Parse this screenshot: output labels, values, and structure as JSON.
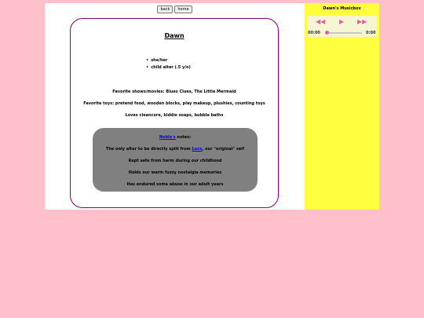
{
  "nav": {
    "back_label": "back",
    "home_label": "home"
  },
  "card": {
    "title": "Dawn",
    "identity": [
      "she/her",
      "child alter (.5 y/o)"
    ],
    "favorite_shows": "Favorite shows/movies: Blues Clues, The Little Mermaid",
    "favorite_toys": "Favorite toys: pretend food, wooden blocks, play makeup, plushies, counting toys",
    "loves": "Loves cleancore, kiddie soaps, bubble baths"
  },
  "notes": {
    "author_link": "Noble's",
    "heading_suffix": " notes:",
    "split_prefix": "The only alter to be directly split from ",
    "split_link": "Lexx",
    "split_suffix": ", our \"original\" self",
    "lines": [
      "Kept safe from harm during our childhood",
      "Holds our warm fuzzy nostalgia memories",
      "Has endured some abuse in our adult years"
    ]
  },
  "musicbox": {
    "title": "Dawn's Musicbox",
    "current_time": "00:00",
    "duration": "0:00",
    "progress": 0,
    "accent_color": "#e060a8",
    "icons": [
      "rewind-icon",
      "play-icon",
      "fast-forward-icon"
    ]
  }
}
